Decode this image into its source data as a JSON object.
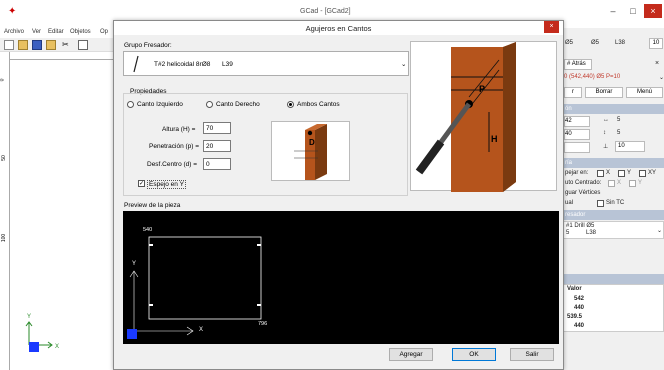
{
  "app": {
    "title": "GCad - [GCad2]",
    "menu": [
      "Archivo",
      "Ver",
      "Editar",
      "Objetos",
      "Op"
    ],
    "min_label": "–",
    "max_label": "□",
    "close_label": "×"
  },
  "dialog": {
    "title": "Agujeros en Cantos",
    "close_label": "×",
    "group_label": "Grupo Fresador:",
    "tool_name": "T#2 helicoidal 8rØ8",
    "tool_len": "L39",
    "props_label": "Propiedades",
    "radios": [
      {
        "label": "Canto Izquierdo",
        "selected": false
      },
      {
        "label": "Canto Derecho",
        "selected": false
      },
      {
        "label": "Ambos Cantos",
        "selected": true
      }
    ],
    "fields": [
      {
        "label": "Altura (H) =",
        "value": "70"
      },
      {
        "label": "Penetración (p) =",
        "value": "20"
      },
      {
        "label": "Desf.Centro (d) =",
        "value": "0"
      }
    ],
    "mirror_label": "Espejo en Y",
    "mirror_checked": true,
    "preview_label": "Preview de la pieza",
    "preview": {
      "x_top": "540",
      "x_bottom": "796",
      "axis_y": "Y",
      "axis_x": "X"
    },
    "illus_small": {
      "d_label": "D"
    },
    "illus_big": {
      "p_label": "P",
      "h_label": "H"
    },
    "buttons": {
      "add": "Agregar",
      "ok": "OK",
      "cancel": "Salir"
    }
  },
  "right_panel": {
    "top_values": [
      "Ø5",
      "Ø5",
      "L38",
      "10"
    ],
    "tab_label": "Atrás",
    "coords": "0 (542,440) Ø5 P=10",
    "btn_borrar": "Borrar",
    "btn_menu": "Menú",
    "fields": [
      {
        "left": "42",
        "icon": "↔",
        "right": "5"
      },
      {
        "left": "40",
        "icon": "↕",
        "right": "5"
      },
      {
        "left": "",
        "icon": "⊥",
        "right": "10"
      }
    ],
    "section_sim": "ría",
    "mirror_label": "pejar en:",
    "mirror_opts": [
      "X",
      "Y",
      "XY"
    ],
    "auto_center": "uto Centrado:",
    "auto_opts": [
      "X",
      "Y"
    ],
    "align_vertices": "guar Vértices",
    "equal_label": "ual",
    "sin_tc": "Sin TC",
    "fresador_hdr": "resador",
    "fresador_tool": "#1 Drill Ø5",
    "fresador_vals": [
      "5",
      "L38"
    ],
    "valor_hdr": "Valor",
    "valores": [
      "542",
      "440",
      "539.5",
      "440"
    ]
  },
  "left_ruler": {
    "marks": [
      "0",
      "50",
      "100"
    ]
  },
  "colors": {
    "accent": "#0078d7",
    "close_red": "#c42b1c",
    "wood": "#b5541c",
    "preview_bg": "#000000"
  }
}
